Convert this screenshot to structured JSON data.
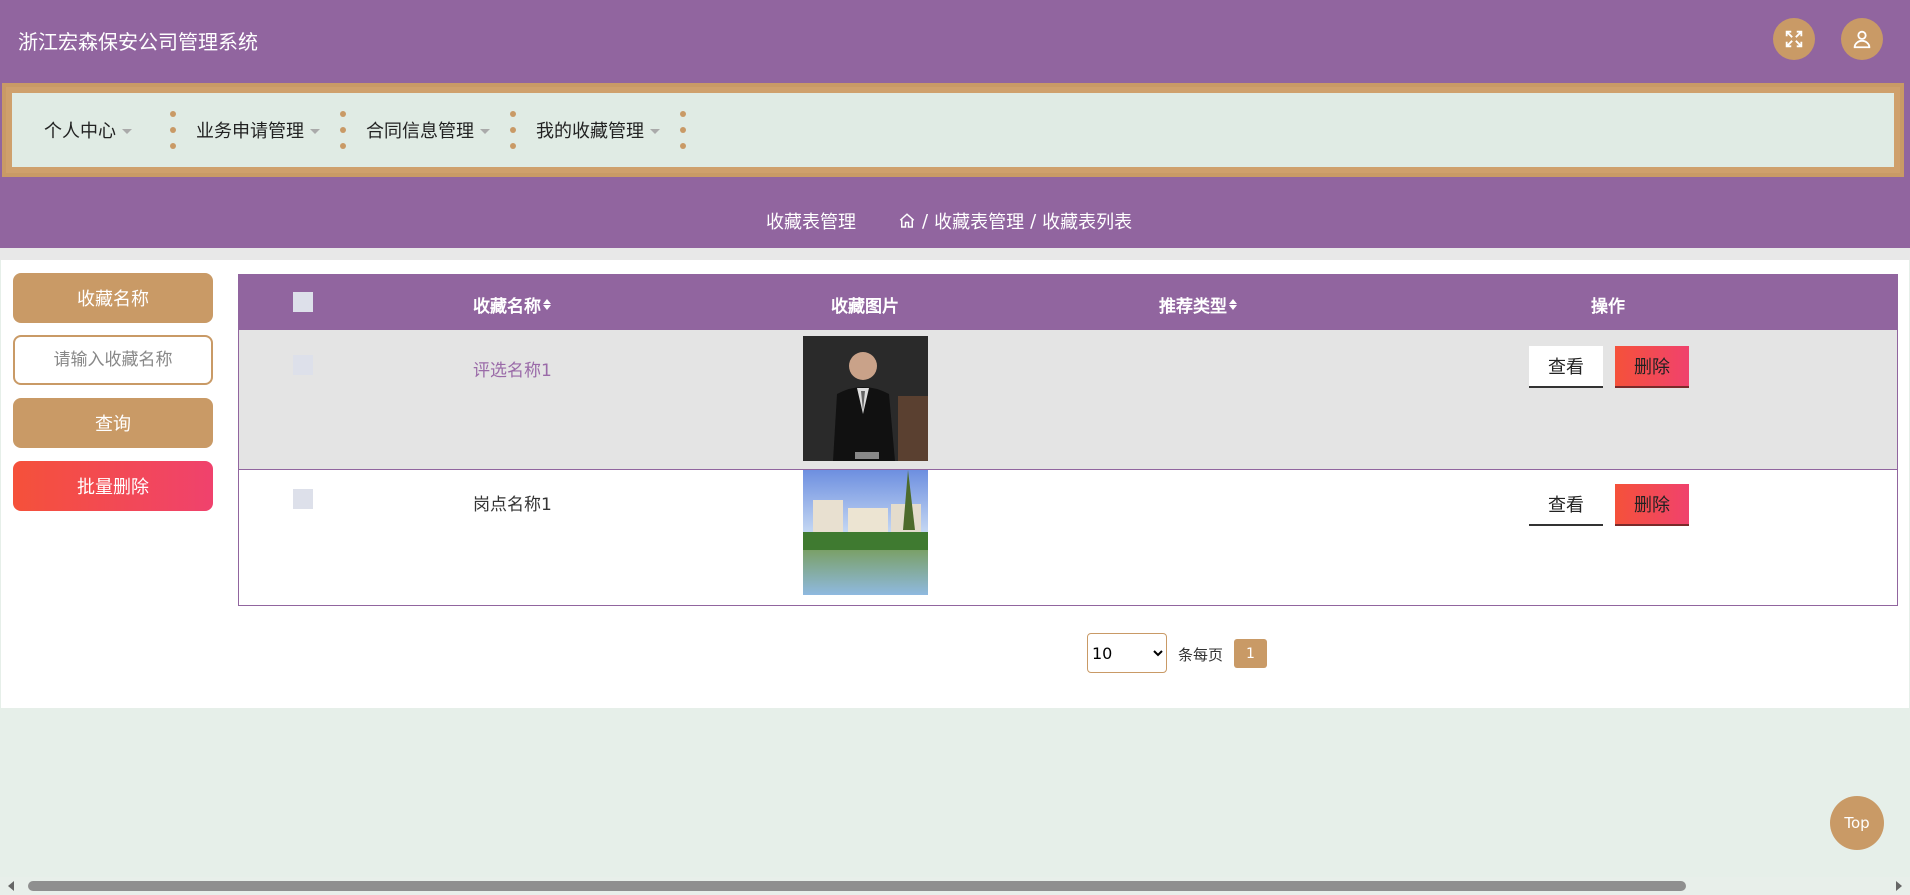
{
  "header": {
    "title": "浙江宏森保安公司管理系统",
    "fullscreen_icon": "fullscreen-icon",
    "user_icon": "user-icon"
  },
  "nav": {
    "items": [
      {
        "label": "个人中心"
      },
      {
        "label": "业务申请管理"
      },
      {
        "label": "合同信息管理"
      },
      {
        "label": "我的收藏管理"
      }
    ]
  },
  "titlebar": {
    "title": "收藏表管理",
    "breadcrumb": [
      "/",
      "收藏表管理",
      "/",
      "收藏表列表"
    ]
  },
  "search": {
    "label": "收藏名称",
    "placeholder": "请输入收藏名称",
    "value": "",
    "query_label": "查询",
    "batch_delete_label": "批量删除"
  },
  "table": {
    "headers": [
      "收藏名称",
      "收藏图片",
      "推荐类型",
      "操作"
    ],
    "rows": [
      {
        "name": "评选名称1",
        "image": "portrait-photo",
        "type": "",
        "view": "查看",
        "delete": "删除"
      },
      {
        "name": "岗点名称1",
        "image": "building-photo",
        "type": "",
        "view": "查看",
        "delete": "删除"
      }
    ]
  },
  "pagination": {
    "page_size": "10",
    "page_size_options": [
      "10"
    ],
    "per_page_text": "条每页",
    "current_page": "1"
  },
  "top_button": "Top",
  "colors": {
    "primary": "#91659f",
    "accent": "#c99a66",
    "nav_bg": "#e0ebe4",
    "danger_start": "#f5513a",
    "danger_end": "#f0426d",
    "link": "#9a6aa8"
  }
}
